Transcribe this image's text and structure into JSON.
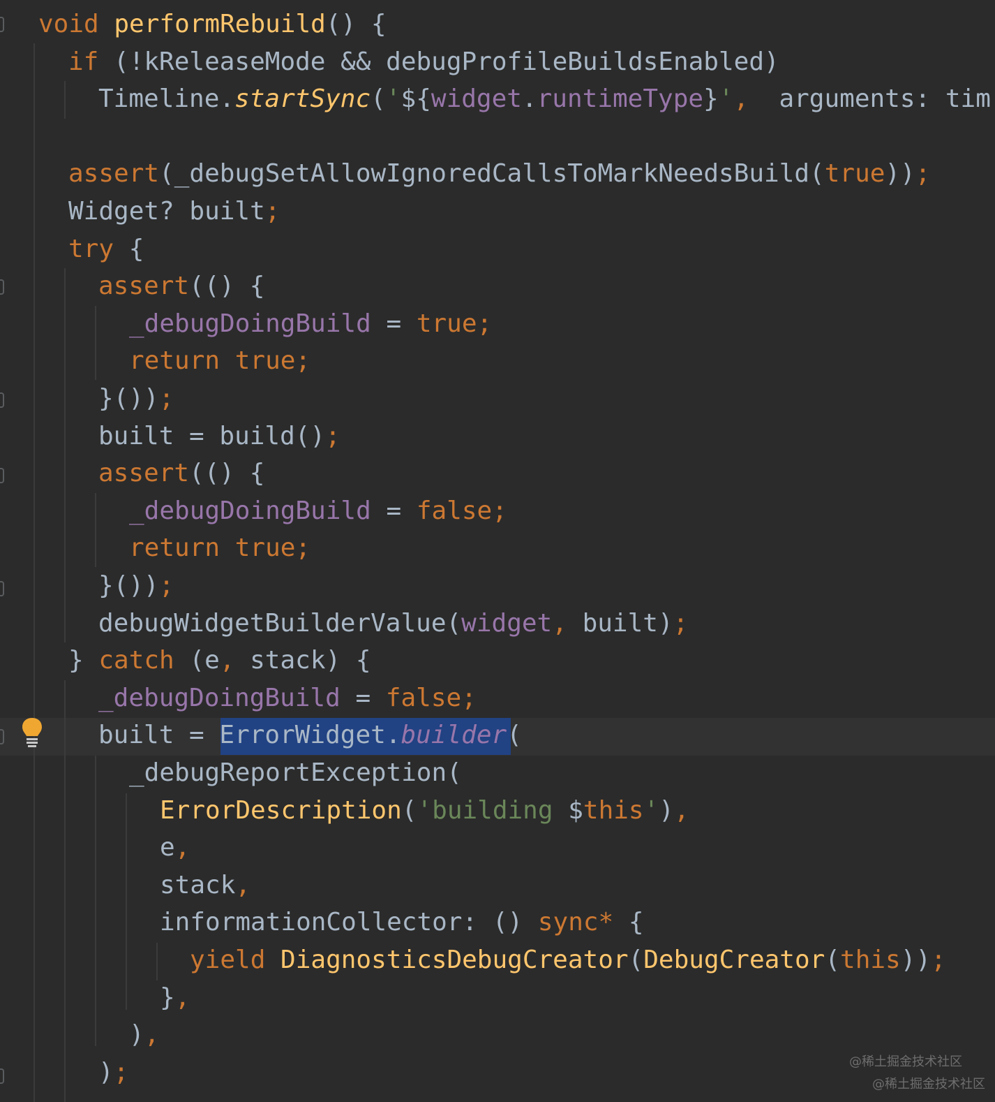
{
  "editor": {
    "background": "#2b2b2b",
    "colors": {
      "keyword": "#cc7832",
      "function": "#ffc66d",
      "field": "#9876aa",
      "string": "#6a8759",
      "text": "#a9b7c6",
      "selection": "#214283"
    },
    "lines": [
      [
        [
          "kw",
          "void "
        ],
        [
          "fn",
          "performRebuild"
        ],
        [
          "txt",
          "() {"
        ]
      ],
      [
        [
          "kw",
          "if "
        ],
        [
          "txt",
          "(!kReleaseMode && debugProfileBuildsEnabled)"
        ]
      ],
      [
        [
          "txt",
          "Timeline."
        ],
        [
          "fn-it",
          "startSync"
        ],
        [
          "txt",
          "("
        ],
        [
          "str",
          "'"
        ],
        [
          "txt",
          "${"
        ],
        [
          "fld",
          "widget"
        ],
        [
          "txt",
          "."
        ],
        [
          "fld",
          "runtimeType"
        ],
        [
          "txt",
          "}"
        ],
        [
          "str",
          "'"
        ],
        [
          "kw",
          ","
        ],
        [
          "txt",
          "  arguments: tim"
        ]
      ],
      [],
      [
        [
          "kw",
          "assert"
        ],
        [
          "txt",
          "("
        ],
        [
          "txt",
          "_debugSetAllowIgnoredCallsToMarkNeedsBuild("
        ],
        [
          "kw",
          "true"
        ],
        [
          "txt",
          "))"
        ],
        [
          "kw",
          ";"
        ]
      ],
      [
        [
          "txt",
          "Widget? built"
        ],
        [
          "kw",
          ";"
        ]
      ],
      [
        [
          "kw",
          "try "
        ],
        [
          "txt",
          "{"
        ]
      ],
      [
        [
          "kw",
          "assert"
        ],
        [
          "txt",
          "(() {"
        ]
      ],
      [
        [
          "fld",
          "_debugDoingBuild "
        ],
        [
          "txt",
          "= "
        ],
        [
          "kw",
          "true;"
        ]
      ],
      [
        [
          "kw",
          "return true;"
        ]
      ],
      [
        [
          "txt",
          "}())"
        ],
        [
          "kw",
          ";"
        ]
      ],
      [
        [
          "txt",
          "built = build()"
        ],
        [
          "kw",
          ";"
        ]
      ],
      [
        [
          "kw",
          "assert"
        ],
        [
          "txt",
          "(() {"
        ]
      ],
      [
        [
          "fld",
          "_debugDoingBuild "
        ],
        [
          "txt",
          "= "
        ],
        [
          "kw",
          "false;"
        ]
      ],
      [
        [
          "kw",
          "return true;"
        ]
      ],
      [
        [
          "txt",
          "}())"
        ],
        [
          "kw",
          ";"
        ]
      ],
      [
        [
          "txt",
          "debugWidgetBuilderValue("
        ],
        [
          "fld",
          "widget"
        ],
        [
          "kw",
          ", "
        ],
        [
          "txt",
          "built)"
        ],
        [
          "kw",
          ";"
        ]
      ],
      [
        [
          "txt",
          "} "
        ],
        [
          "kw",
          "catch "
        ],
        [
          "txt",
          "(e"
        ],
        [
          "kw",
          ", "
        ],
        [
          "txt",
          "stack) {"
        ]
      ],
      [
        [
          "fld",
          "_debugDoingBuild "
        ],
        [
          "txt",
          "= "
        ],
        [
          "kw",
          "false;"
        ]
      ],
      [
        [
          "txt",
          "built = "
        ],
        [
          "txt",
          "ErrorWidget."
        ],
        [
          "fld-it",
          "builder"
        ],
        [
          "txt",
          "("
        ]
      ],
      [
        [
          "txt",
          "_debugReportException("
        ]
      ],
      [
        [
          "fn",
          "ErrorDescription"
        ],
        [
          "txt",
          "("
        ],
        [
          "str",
          "'building "
        ],
        [
          "txt",
          "$"
        ],
        [
          "kw",
          "this"
        ],
        [
          "str",
          "'"
        ],
        [
          "txt",
          ")"
        ],
        [
          "kw",
          ","
        ]
      ],
      [
        [
          "txt",
          "e"
        ],
        [
          "kw",
          ","
        ]
      ],
      [
        [
          "txt",
          "stack"
        ],
        [
          "kw",
          ","
        ]
      ],
      [
        [
          "txt",
          "informationCollector: () "
        ],
        [
          "kw",
          "sync* "
        ],
        [
          "txt",
          "{"
        ]
      ],
      [
        [
          "kw",
          "yield "
        ],
        [
          "fn",
          "DiagnosticsDebugCreator"
        ],
        [
          "txt",
          "("
        ],
        [
          "fn",
          "DebugCreator"
        ],
        [
          "txt",
          "("
        ],
        [
          "kw",
          "this"
        ],
        [
          "txt",
          "))"
        ],
        [
          "kw",
          ";"
        ]
      ],
      [
        [
          "txt",
          "}"
        ],
        [
          "kw",
          ","
        ]
      ],
      [
        [
          "txt",
          ")"
        ],
        [
          "kw",
          ","
        ]
      ],
      [
        [
          "txt",
          ")"
        ],
        [
          "kw",
          ";"
        ]
      ]
    ]
  },
  "watermarks": [
    "@稀土掘金技术社区",
    "@稀土掘金技术社区"
  ]
}
